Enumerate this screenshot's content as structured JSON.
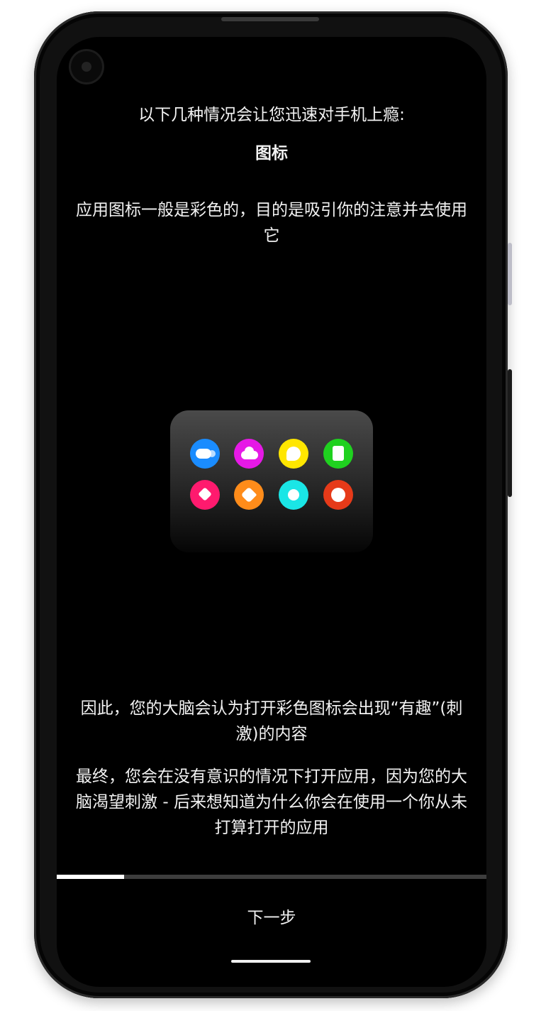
{
  "onboarding": {
    "intro": "以下几种情况会让您迅速对手机上瘾:",
    "heading": "图标",
    "description": "应用图标一般是彩色的，目的是吸引你的注意并去使用它",
    "paragraph_1": "因此，您的大脑会认为打开彩色图标会出现“有趣”(刺激)的内容",
    "paragraph_2": "最终，您会在没有意识的情况下打开应用，因为您的大脑渴望刺激 - 后来想知道为什么你会在使用一个你从未打算打开的应用"
  },
  "illustration": {
    "icons": [
      {
        "name": "toggle-icon",
        "color": "#1a8cff"
      },
      {
        "name": "cloud-icon",
        "color": "#e619e6"
      },
      {
        "name": "chat-bubble-icon",
        "color": "#ffe600"
      },
      {
        "name": "document-icon",
        "color": "#1fd11f"
      },
      {
        "name": "heart-icon",
        "color": "#ff1a6e"
      },
      {
        "name": "tag-icon",
        "color": "#ff8c1a"
      },
      {
        "name": "star-icon",
        "color": "#1ae6e6"
      },
      {
        "name": "pie-icon",
        "color": "#e63a19"
      }
    ]
  },
  "progress": {
    "fraction": 0.157
  },
  "footer": {
    "next_label": "下一步"
  },
  "colors": {
    "background": "#000000",
    "text": "#f2f2f2",
    "progress_fill": "#ffffff",
    "progress_track": "#3d3d3d"
  }
}
